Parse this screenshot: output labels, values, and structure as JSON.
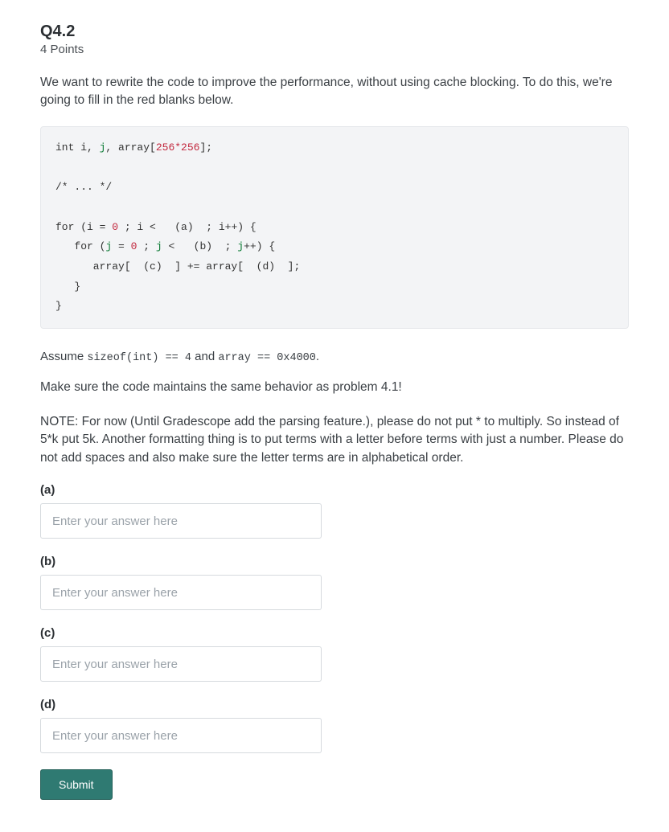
{
  "question": {
    "title": "Q4.2",
    "points": "4 Points",
    "intro": "We want to rewrite the code to improve the performance, without using cache blocking. To do this, we're going to fill in the red blanks below."
  },
  "code": {
    "line1_pre": "int i, ",
    "line1_j": "j",
    "line1_mid": ", array[",
    "line1_num": "256*256",
    "line1_post": "];",
    "line2": "/* ... */",
    "line3_a": "for (i = ",
    "line3_zero": "0",
    "line3_b": " ; i <   (a)  ; i++) {",
    "line4_a": "   for (",
    "line4_j": "j",
    "line4_eq": " = ",
    "line4_zero": "0",
    "line4_b": " ; ",
    "line4_j2": "j",
    "line4_c": " <   (b)  ; ",
    "line4_j3": "j",
    "line4_d": "++) {",
    "line5": "      array[  (c)  ] += array[  (d)  ];",
    "line6": "   }",
    "line7": "}"
  },
  "assume": {
    "pre": "Assume ",
    "sizeof": "sizeof(int) == 4",
    "mid": " and ",
    "arr": "array == 0x4000",
    "post": "."
  },
  "behavior_note": "Make sure the code maintains the same behavior as problem 4.1!",
  "note": "NOTE: For now (Until Gradescope add the parsing feature.), please do not put * to multiply. So instead of 5*k put 5k. Another formatting thing is to put terms with a letter before terms with just a number. Please do not add spaces and also make sure the letter terms are in alphabetical order.",
  "fields": {
    "a": {
      "label": "(a)",
      "placeholder": "Enter your answer here"
    },
    "b": {
      "label": "(b)",
      "placeholder": "Enter your answer here"
    },
    "c": {
      "label": "(c)",
      "placeholder": "Enter your answer here"
    },
    "d": {
      "label": "(d)",
      "placeholder": "Enter your answer here"
    }
  },
  "submit_label": "Submit"
}
